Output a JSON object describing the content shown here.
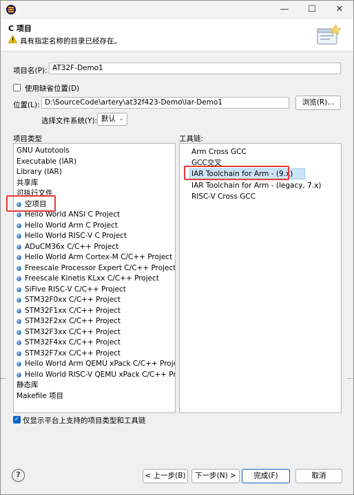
{
  "window": {
    "title": "",
    "controls": {
      "minimize": "—",
      "maximize": "☐",
      "close": "✕"
    }
  },
  "header": {
    "title": "C 项目",
    "message": "具有指定名称的目录已经存在。"
  },
  "project_name": {
    "label": "项目名(P):",
    "value": "AT32F-Demo1"
  },
  "default_location": {
    "label": "使用缺省位置(D)",
    "checked": false
  },
  "location": {
    "label": "位置(L):",
    "value": "D:\\SourceCode\\artery\\at32f423-Demo\\Iar-Demo1",
    "browse_label": "浏览(R)..."
  },
  "filesystem": {
    "label": "选择文件系统(Y):",
    "value": "默认"
  },
  "project_types": {
    "label": "项目类型",
    "items": [
      {
        "label": "GNU Autotools",
        "bullet": false
      },
      {
        "label": "Executable (IAR)",
        "bullet": false
      },
      {
        "label": "Library (IAR)",
        "bullet": false
      },
      {
        "label": "共享库",
        "bullet": false
      },
      {
        "label": "可执行文件",
        "bullet": false
      },
      {
        "label": "空项目",
        "bullet": true,
        "highlighted": true
      },
      {
        "label": "Hello World ANSI C Project",
        "bullet": true
      },
      {
        "label": "Hello World Arm C Project",
        "bullet": true
      },
      {
        "label": "Hello World RISC-V C Project",
        "bullet": true
      },
      {
        "label": "ADuCM36x C/C++ Project",
        "bullet": true
      },
      {
        "label": "Hello World Arm Cortex-M C/C++ Project",
        "bullet": true
      },
      {
        "label": "Freescale Processor Expert C/C++ Project",
        "bullet": true
      },
      {
        "label": "Freescale Kinetis KLxx C/C++ Project",
        "bullet": true
      },
      {
        "label": "SiFive RISC-V C/C++ Project",
        "bullet": true
      },
      {
        "label": "STM32F0xx C/C++ Project",
        "bullet": true
      },
      {
        "label": "STM32F1xx C/C++ Project",
        "bullet": true
      },
      {
        "label": "STM32F2xx C/C++ Project",
        "bullet": true
      },
      {
        "label": "STM32F3xx C/C++ Project",
        "bullet": true
      },
      {
        "label": "STM32F4xx C/C++ Project",
        "bullet": true
      },
      {
        "label": "STM32F7xx C/C++ Project",
        "bullet": true
      },
      {
        "label": "Hello World Arm QEMU xPack C/C++ Project",
        "bullet": true
      },
      {
        "label": "Hello World RISC-V QEMU xPack C/C++ Project",
        "bullet": true
      },
      {
        "label": "静态库",
        "bullet": false
      },
      {
        "label": "Makefile 项目",
        "bullet": false
      }
    ]
  },
  "toolchains": {
    "label": "工具链:",
    "items": [
      {
        "label": "Arm Cross GCC"
      },
      {
        "label": "GCC交叉"
      },
      {
        "label": "IAR Toolchain for Arm - (9.x)",
        "selected": true
      },
      {
        "label": "IAR Toolchain for Arm - (legacy, 7.x)"
      },
      {
        "label": "RISC-V Cross GCC"
      }
    ]
  },
  "supported_only": {
    "label": "仅显示平台上支持的项目类型和工具链",
    "checked": true
  },
  "footer": {
    "help": "?",
    "back": "< 上一步(B)",
    "next": "下一步(N) >",
    "finish": "完成(F)",
    "cancel": "取消"
  },
  "colors": {
    "accent": "#0a64c8",
    "highlight_box": "#e53935",
    "selection": "#cce4f7"
  }
}
